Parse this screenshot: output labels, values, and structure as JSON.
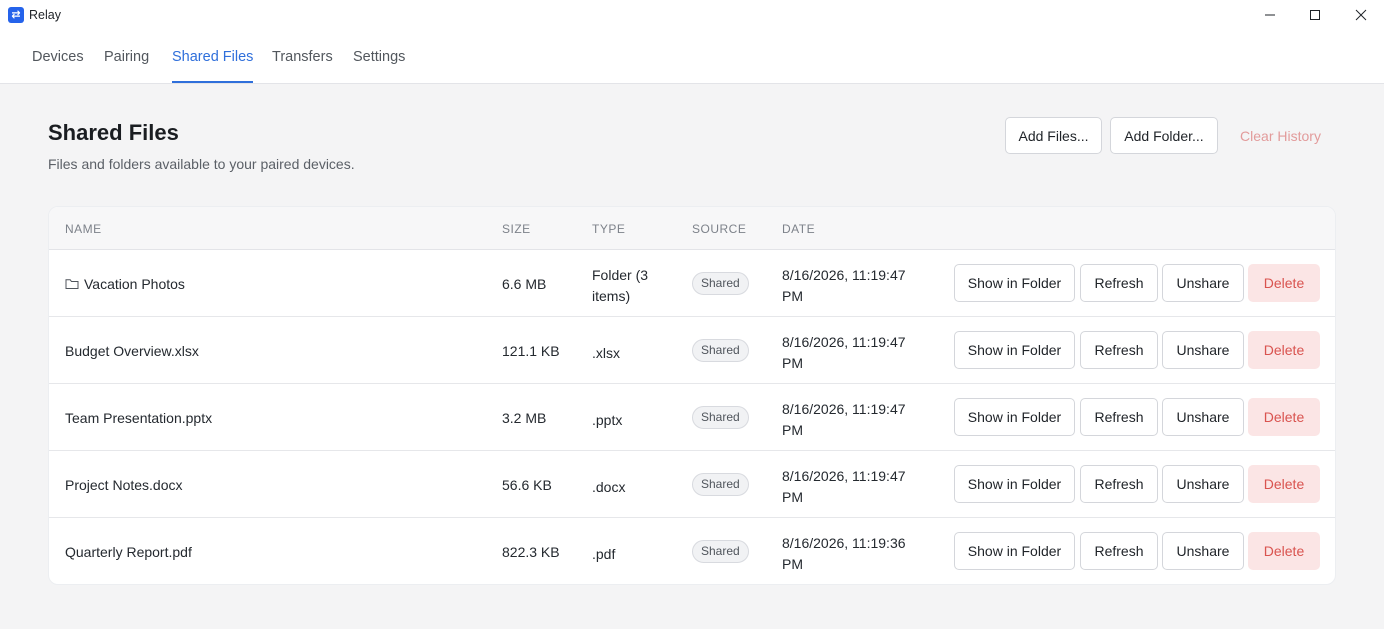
{
  "app": {
    "title": "Relay",
    "icon": "swap-arrows-icon"
  },
  "tabs": [
    "Devices",
    "Pairing",
    "Shared Files",
    "Transfers",
    "Settings"
  ],
  "active_tab": "Shared Files",
  "page": {
    "title": "Shared Files",
    "subtitle": "Files and folders available to your paired devices.",
    "add_files": "Add Files...",
    "add_folder": "Add Folder...",
    "clear_history": "Clear History"
  },
  "table": {
    "headers": [
      "NAME",
      "SIZE",
      "TYPE",
      "SOURCE",
      "DATE"
    ],
    "actions": {
      "show": "Show in Folder",
      "refresh": "Refresh",
      "unshare": "Unshare",
      "delete": "Delete"
    },
    "rows": [
      {
        "name": "Vacation Photos",
        "is_folder": true,
        "size": "6.6 MB",
        "type": "Folder (3 items)",
        "source": "Shared",
        "date": "8/16/2026, 11:19:47 PM"
      },
      {
        "name": "Budget Overview.xlsx",
        "is_folder": false,
        "size": "121.1 KB",
        "type": ".xlsx",
        "source": "Shared",
        "date": "8/16/2026, 11:19:47 PM"
      },
      {
        "name": "Team Presentation.pptx",
        "is_folder": false,
        "size": "3.2 MB",
        "type": ".pptx",
        "source": "Shared",
        "date": "8/16/2026, 11:19:47 PM"
      },
      {
        "name": "Project Notes.docx",
        "is_folder": false,
        "size": "56.6 KB",
        "type": ".docx",
        "source": "Shared",
        "date": "8/16/2026, 11:19:47 PM"
      },
      {
        "name": "Quarterly Report.pdf",
        "is_folder": false,
        "size": "822.3 KB",
        "type": ".pdf",
        "source": "Shared",
        "date": "8/16/2026, 11:19:36 PM"
      }
    ]
  },
  "colors": {
    "accent": "#2f6fdb",
    "danger": "#d9534f",
    "danger_bg": "#fbe5e5"
  }
}
